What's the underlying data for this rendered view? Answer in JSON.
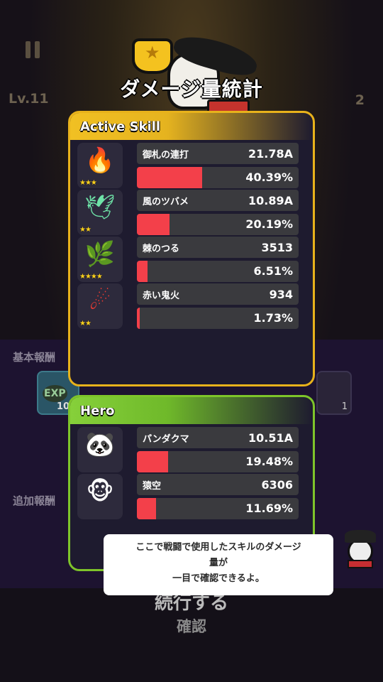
{
  "background": {
    "level": "Lv.11",
    "right_counter": "2",
    "base_reward_label": "基本報酬",
    "extra_reward_label": "追加報酬",
    "exp_label": "EXP",
    "exp_count": "10",
    "slot_count": "1",
    "continue_text": "続行する",
    "confirm_text": "確認"
  },
  "title": "ダメージ量統計",
  "active_skill": {
    "header": "Active Skill",
    "rows": [
      {
        "name": "御札の連打",
        "value": "21.78A",
        "percent_text": "40.39%",
        "percent": 40.39,
        "stars": "★★★",
        "icon": "fire-talisman-icon"
      },
      {
        "name": "風のツバメ",
        "value": "10.89A",
        "percent_text": "20.19%",
        "percent": 20.19,
        "stars": "★★",
        "icon": "wind-swallow-icon"
      },
      {
        "name": "棘のつる",
        "value": "3513",
        "percent_text": "6.51%",
        "percent": 6.51,
        "stars": "★★★★",
        "icon": "thorn-vine-icon"
      },
      {
        "name": "赤い鬼火",
        "value": "934",
        "percent_text": "1.73%",
        "percent": 1.73,
        "stars": "★★",
        "icon": "red-wisp-icon"
      }
    ]
  },
  "hero": {
    "header": "Hero",
    "rows": [
      {
        "name": "パンダクマ",
        "value": "10.51A",
        "percent_text": "19.48%",
        "percent": 19.48,
        "icon": "panda-icon"
      },
      {
        "name": "猿空",
        "value": "6306",
        "percent_text": "11.69%",
        "percent": 11.69,
        "icon": "monkey-icon"
      }
    ]
  },
  "tooltip": {
    "line1": "ここで戦闘で使用したスキルのダメージ",
    "line2": "量が",
    "line3": "一目で確認できるよ。"
  },
  "colors": {
    "active_border": "#e8b21b",
    "hero_border": "#7ec42a",
    "bar_fill": "#f3404a",
    "panel_bg": "#1e1b2f"
  }
}
